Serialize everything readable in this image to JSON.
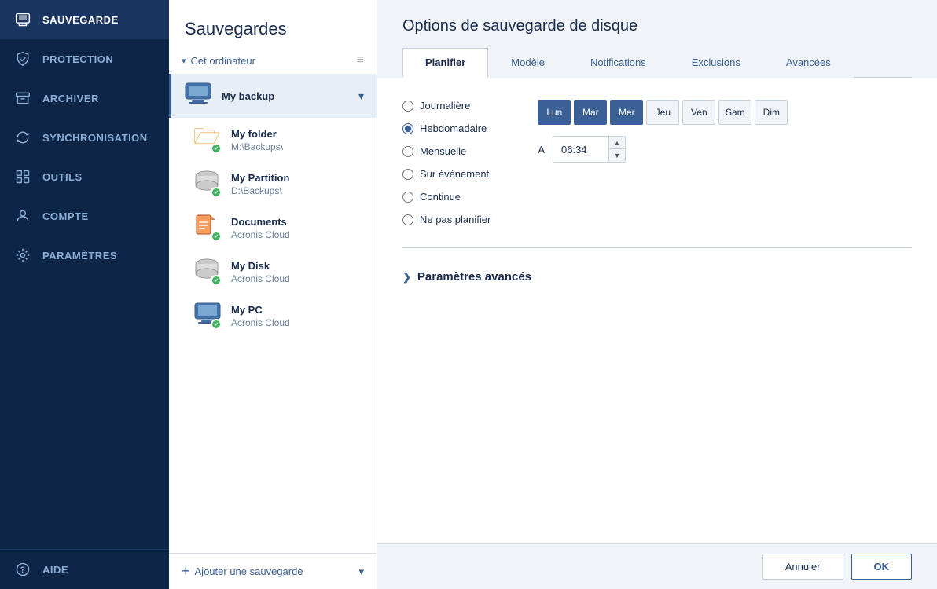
{
  "sidebar": {
    "items": [
      {
        "id": "sauvegarde",
        "label": "SAUVEGARDE",
        "active": true
      },
      {
        "id": "protection",
        "label": "PROTECTION",
        "active": false
      },
      {
        "id": "archiver",
        "label": "ARCHIVER",
        "active": false
      },
      {
        "id": "synchronisation",
        "label": "SYNCHRONISATION",
        "active": false
      },
      {
        "id": "outils",
        "label": "OUTILS",
        "active": false
      },
      {
        "id": "compte",
        "label": "COMPTE",
        "active": false
      },
      {
        "id": "parametres",
        "label": "PARAMÈTRES",
        "active": false
      }
    ],
    "bottom_item": {
      "label": "AIDE"
    }
  },
  "backup_panel": {
    "title": "Sauvegardes",
    "computer_section": "Cet ordinateur",
    "items": [
      {
        "id": "my_backup",
        "name": "My backup",
        "path": "",
        "icon": "monitor",
        "status": "none",
        "active": true,
        "expanded": true
      },
      {
        "id": "my_folder",
        "name": "My folder",
        "path": "M:\\Backups\\",
        "icon": "folder",
        "status": "green"
      },
      {
        "id": "my_partition",
        "name": "My Partition",
        "path": "D:\\Backups\\",
        "icon": "drive",
        "status": "green"
      },
      {
        "id": "documents",
        "name": "Documents",
        "path": "Acronis Cloud",
        "icon": "docs",
        "status": "green"
      },
      {
        "id": "my_disk",
        "name": "My Disk",
        "path": "Acronis Cloud",
        "icon": "drive",
        "status": "green"
      },
      {
        "id": "my_pc",
        "name": "My PC",
        "path": "Acronis Cloud",
        "icon": "monitor",
        "status": "green"
      }
    ],
    "add_label": "Ajouter une sauvegarde"
  },
  "content": {
    "title": "Options de sauvegarde de disque",
    "tabs": [
      {
        "id": "planifier",
        "label": "Planifier",
        "active": true
      },
      {
        "id": "modele",
        "label": "Modèle",
        "active": false
      },
      {
        "id": "notifications",
        "label": "Notifications",
        "active": false
      },
      {
        "id": "exclusions",
        "label": "Exclusions",
        "active": false
      },
      {
        "id": "avancees",
        "label": "Avancées",
        "active": false
      }
    ],
    "schedule": {
      "options": [
        {
          "id": "journaliere",
          "label": "Journalière",
          "selected": false
        },
        {
          "id": "hebdomadaire",
          "label": "Hebdomadaire",
          "selected": true
        },
        {
          "id": "mensuelle",
          "label": "Mensuelle",
          "selected": false
        },
        {
          "id": "sur_evenement",
          "label": "Sur événement",
          "selected": false
        },
        {
          "id": "continue",
          "label": "Continue",
          "selected": false
        },
        {
          "id": "ne_pas_planifier",
          "label": "Ne pas planifier",
          "selected": false
        }
      ],
      "days": [
        {
          "id": "lun",
          "label": "Lun",
          "active": true
        },
        {
          "id": "mar",
          "label": "Mar",
          "active": true
        },
        {
          "id": "mer",
          "label": "Mer",
          "active": true
        },
        {
          "id": "jeu",
          "label": "Jeu",
          "active": false
        },
        {
          "id": "ven",
          "label": "Ven",
          "active": false
        },
        {
          "id": "sam",
          "label": "Sam",
          "active": false
        },
        {
          "id": "dim",
          "label": "Dim",
          "active": false
        }
      ],
      "time_label": "A",
      "time_value": "06:34"
    },
    "advanced_section_label": "Paramètres avancés",
    "buttons": {
      "cancel": "Annuler",
      "ok": "OK"
    }
  }
}
